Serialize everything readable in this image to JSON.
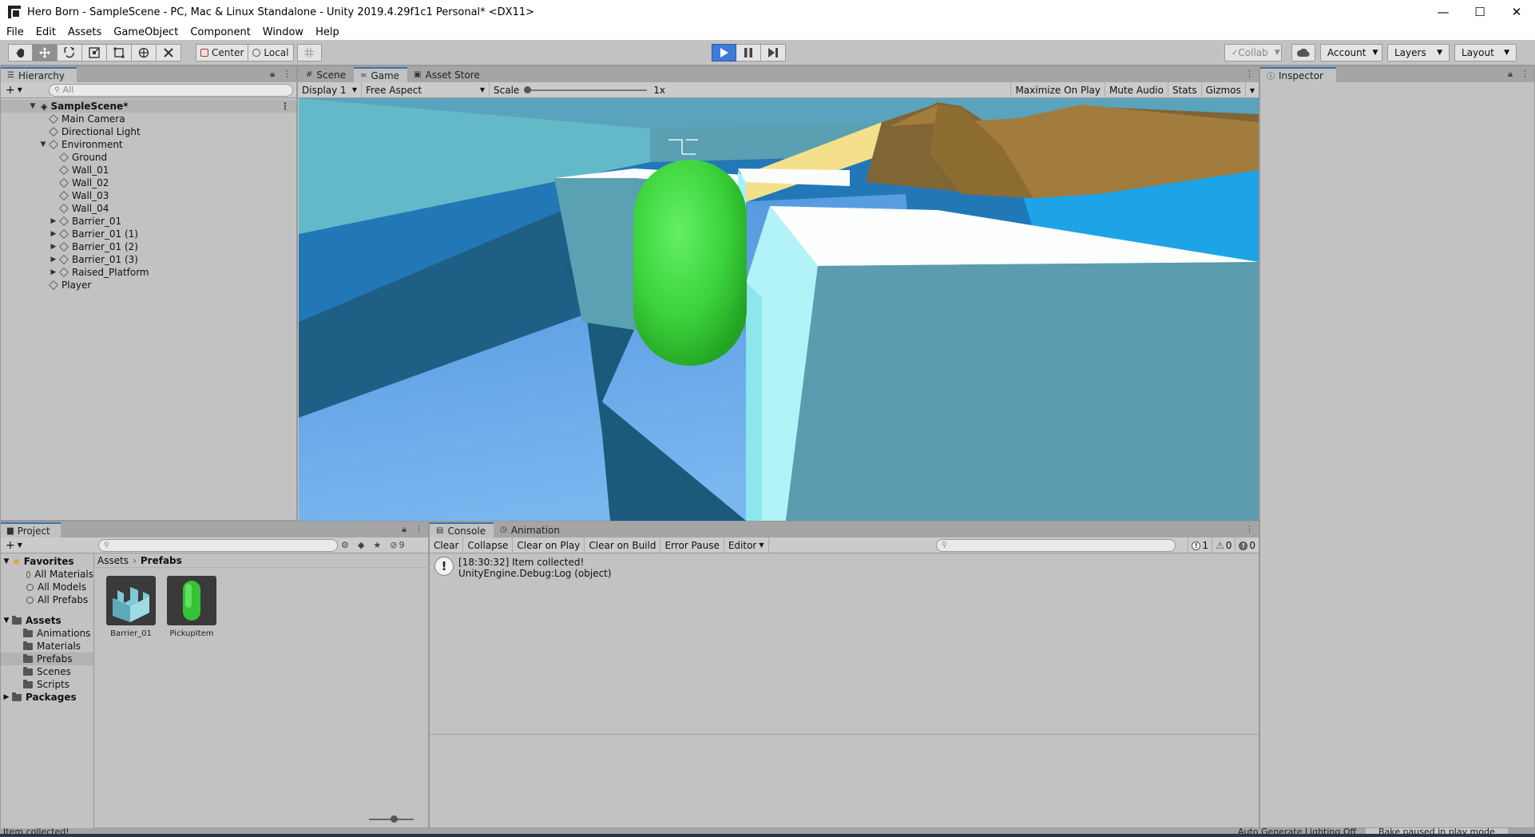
{
  "window": {
    "title": "Hero Born - SampleScene - PC, Mac & Linux Standalone - Unity 2019.4.29f1c1 Personal* <DX11>",
    "minimize": "—",
    "maximize": "☐",
    "close": "✕"
  },
  "menu": [
    "File",
    "Edit",
    "Assets",
    "GameObject",
    "Component",
    "Window",
    "Help"
  ],
  "toolbar": {
    "pivot": "Center",
    "space": "Local",
    "play_state": "playing",
    "collab": "Collab",
    "account": "Account",
    "layers": "Layers",
    "layout": "Layout"
  },
  "hierarchy": {
    "tab": "Hierarchy",
    "search_placeholder": "All",
    "scene": "SampleScene*",
    "items": [
      {
        "label": "Main Camera",
        "depth": 1,
        "expander": ""
      },
      {
        "label": "Directional Light",
        "depth": 1,
        "expander": ""
      },
      {
        "label": "Environment",
        "depth": 1,
        "expander": "▼"
      },
      {
        "label": "Ground",
        "depth": 2,
        "expander": ""
      },
      {
        "label": "Wall_01",
        "depth": 2,
        "expander": ""
      },
      {
        "label": "Wall_02",
        "depth": 2,
        "expander": ""
      },
      {
        "label": "Wall_03",
        "depth": 2,
        "expander": ""
      },
      {
        "label": "Wall_04",
        "depth": 2,
        "expander": ""
      },
      {
        "label": "Barrier_01",
        "depth": 2,
        "expander": "▶"
      },
      {
        "label": "Barrier_01 (1)",
        "depth": 2,
        "expander": "▶"
      },
      {
        "label": "Barrier_01 (2)",
        "depth": 2,
        "expander": "▶"
      },
      {
        "label": "Barrier_01 (3)",
        "depth": 2,
        "expander": "▶"
      },
      {
        "label": "Raised_Platform",
        "depth": 2,
        "expander": "▶"
      },
      {
        "label": "Player",
        "depth": 1,
        "expander": ""
      }
    ]
  },
  "game_tabs": [
    {
      "label": "Scene",
      "icon": "#",
      "active": false
    },
    {
      "label": "Game",
      "icon": "∞",
      "active": true
    },
    {
      "label": "Asset Store",
      "icon": "▣",
      "active": false
    }
  ],
  "game_bar": {
    "display": "Display 1",
    "aspect": "Free Aspect",
    "scale_label": "Scale",
    "scale_value": "1x",
    "scale_fraction": 0.0,
    "maximize": "Maximize On Play",
    "mute": "Mute Audio",
    "stats": "Stats",
    "gizmos": "Gizmos"
  },
  "inspector": {
    "tab": "Inspector"
  },
  "project": {
    "tab": "Project",
    "hidden_count": "9",
    "favorites": {
      "label": "Favorites",
      "items": [
        "All Materials",
        "All Models",
        "All Prefabs"
      ]
    },
    "assets": {
      "label": "Assets",
      "folders": [
        "Animations",
        "Materials",
        "Prefabs",
        "Scenes",
        "Scripts"
      ],
      "selected": "Prefabs"
    },
    "packages": "Packages",
    "breadcrumb": [
      "Assets",
      "Prefabs"
    ],
    "breadcrumb_sep": "›",
    "tiles": [
      "Barrier_01",
      "PickupItem"
    ],
    "zoom_fraction": 0.55
  },
  "console": {
    "tabs": [
      {
        "label": "Console",
        "active": true
      },
      {
        "label": "Animation",
        "active": false
      }
    ],
    "buttons": [
      "Clear",
      "Collapse",
      "Clear on Play",
      "Clear on Build",
      "Error Pause",
      "Editor"
    ],
    "counts": {
      "info": "1",
      "warning": "0",
      "error": "0"
    },
    "messages": [
      {
        "line1": "[18:30:32] Item collected!",
        "line2": "UnityEngine.Debug:Log (object)"
      }
    ]
  },
  "statusbar": {
    "message": "Item collected!",
    "lighting": "Auto Generate Lighting Off",
    "bake": "Bake paused in play mode"
  },
  "colors": {
    "play_accent": "#3d7bd8",
    "panel_bg": "#c2c2c2",
    "capsule_green": "#3fd23f"
  }
}
